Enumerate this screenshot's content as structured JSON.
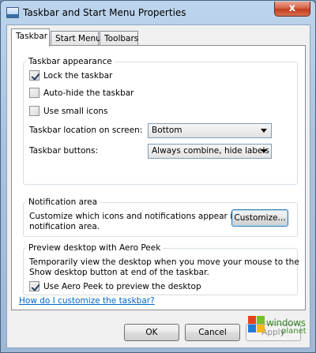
{
  "window": {
    "title": "Taskbar and Start Menu Properties",
    "close_label": "x"
  },
  "tabs": [
    {
      "label": "Taskbar",
      "active": true
    },
    {
      "label": "Start Menu",
      "active": false
    },
    {
      "label": "Toolbars",
      "active": false
    }
  ],
  "appearance": {
    "heading": "Taskbar appearance",
    "lock_label": "Lock the taskbar",
    "lock_checked": true,
    "autohide_label": "Auto-hide the taskbar",
    "autohide_checked": false,
    "small_icons_label": "Use small icons",
    "small_icons_checked": false,
    "location_label": "Taskbar location on screen:",
    "location_value": "Bottom",
    "buttons_label": "Taskbar buttons:",
    "buttons_value": "Always combine, hide labels"
  },
  "notification": {
    "heading": "Notification area",
    "description_line1": "Customize which icons and notifications appear in the",
    "description_line2": "notification area.",
    "customize_label": "Customize..."
  },
  "peek": {
    "heading": "Preview desktop with Aero Peek",
    "description_line1": "Temporarily view the desktop when you move your mouse to the",
    "description_line2": "Show desktop button at end of the taskbar.",
    "checkbox_label": "Use Aero Peek to preview the desktop",
    "checked": true
  },
  "help_link": "How do I customize the taskbar?",
  "footer": {
    "ok_label": "OK",
    "cancel_label": "Cancel",
    "apply_label": "Apply"
  },
  "watermark": {
    "line1": "windows",
    "line2": "planet",
    "flag_colors": [
      "#e2421d",
      "#7bbf2a",
      "#1f7ad6",
      "#f4b81a"
    ]
  }
}
